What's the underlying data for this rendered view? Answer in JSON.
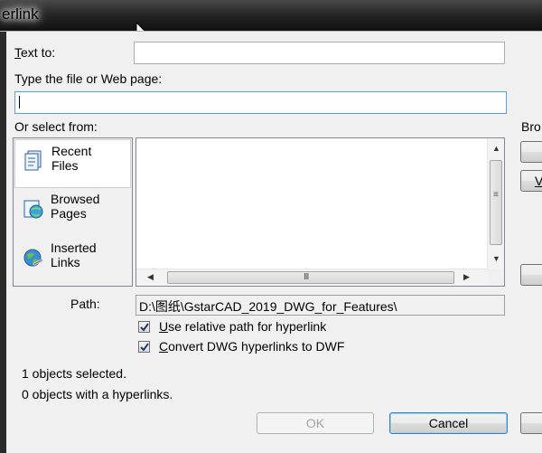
{
  "window": {
    "title": "erlink"
  },
  "labels": {
    "text_to": "Text to:",
    "type_file": "Type the file or Web page:",
    "or_select": "Or select from:",
    "browse": "Bro",
    "path": "Path:"
  },
  "inputs": {
    "text_to_value": "",
    "file_value": ""
  },
  "places": [
    {
      "line1": "Recent",
      "line2": "Files"
    },
    {
      "line1": "Browsed",
      "line2": "Pages"
    },
    {
      "line1": "Inserted",
      "line2": "Links"
    }
  ],
  "path_value": "D:\\图纸\\GstarCAD_2019_DWG_for_Features\\",
  "checkboxes": [
    {
      "label": "Use relative path for hyperlink",
      "checked": true
    },
    {
      "label": "Convert DWG hyperlinks to DWF",
      "checked": true
    }
  ],
  "status": {
    "selected": "1 objects selected.",
    "with_links": "0 objects with a hyperlinks."
  },
  "buttons": {
    "ok": "OK",
    "cancel": "Cancel",
    "side_v": "V"
  },
  "colors": {
    "focus_border": "#569de5",
    "default_button_border": "#3c7fb1"
  }
}
